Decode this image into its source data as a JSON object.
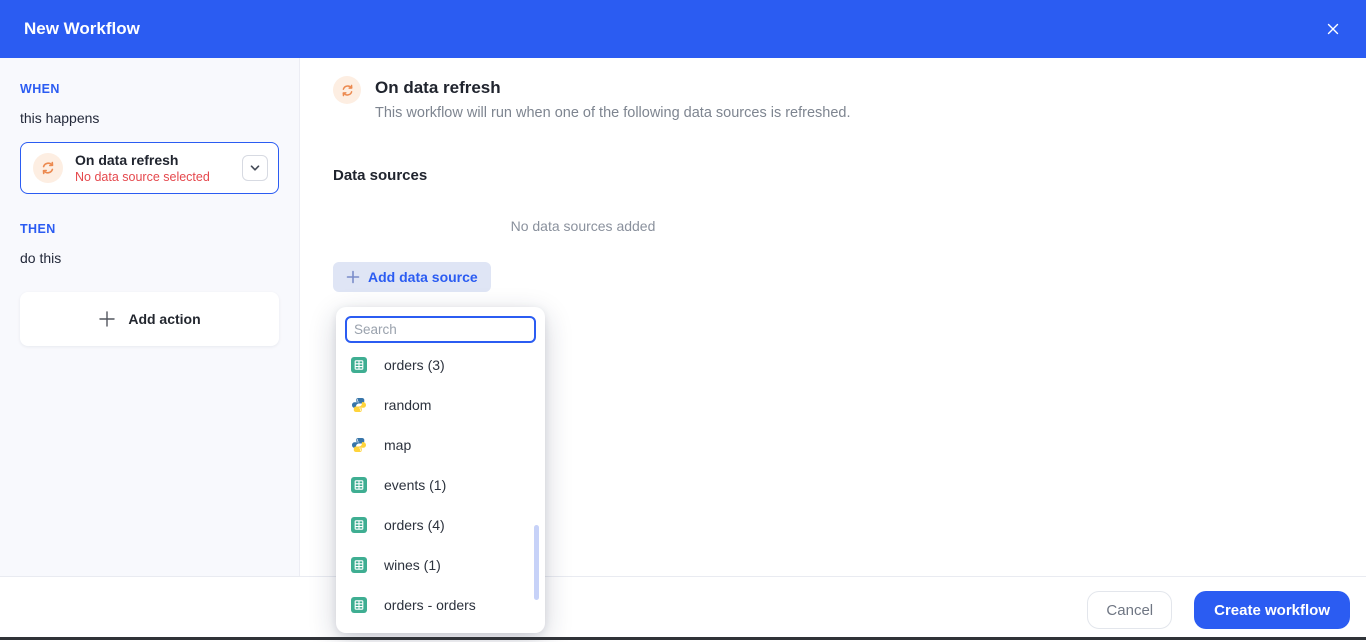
{
  "header": {
    "title": "New Workflow"
  },
  "sidebar": {
    "when_label": "WHEN",
    "when_caption": "this happens",
    "trigger_card": {
      "title": "On data refresh",
      "subtitle": "No data source selected"
    },
    "then_label": "THEN",
    "then_caption": "do this",
    "add_action_label": "Add action"
  },
  "main": {
    "trigger_title": "On data refresh",
    "trigger_description": "This workflow will run when one of the following data sources is refreshed.",
    "section_title": "Data sources",
    "empty_message": "No data sources added",
    "add_data_source_label": "Add data source"
  },
  "dropdown": {
    "search_placeholder": "Search",
    "items": [
      {
        "label": "orders (3)",
        "icon": "sheet-icon"
      },
      {
        "label": "random",
        "icon": "python-icon"
      },
      {
        "label": "map",
        "icon": "python-icon"
      },
      {
        "label": "events (1)",
        "icon": "sheet-icon"
      },
      {
        "label": "orders (4)",
        "icon": "sheet-icon"
      },
      {
        "label": "wines (1)",
        "icon": "sheet-icon"
      },
      {
        "label": "orders - orders",
        "icon": "sheet-icon"
      }
    ]
  },
  "footer": {
    "cancel_label": "Cancel",
    "create_label": "Create workflow"
  },
  "colors": {
    "brand_blue": "#2b5cf2",
    "accent_orange": "#ec8a50",
    "error_red": "#e5484d",
    "sheet_green": "#3fae92",
    "scrollbar_thumb": "#c7d2f8"
  }
}
